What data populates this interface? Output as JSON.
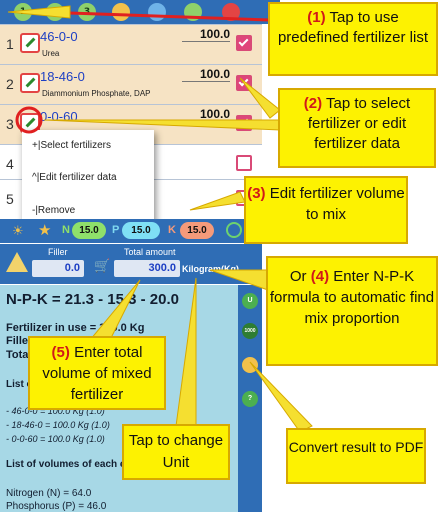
{
  "toolbar": {
    "icons": [
      "1",
      "2",
      "3",
      "pen",
      "globe",
      "4",
      "pdf"
    ]
  },
  "rows": [
    {
      "num": "1",
      "name": "46-0-0",
      "desc": "Urea",
      "value": "100.0",
      "checked": true
    },
    {
      "num": "2",
      "name": "18-46-0",
      "desc": "Diammonium Phosphate, DAP",
      "value": "100.0",
      "checked": true
    },
    {
      "num": "3",
      "name": "0-0-60",
      "desc": "",
      "value": "100.0",
      "checked": true
    },
    {
      "num": "4",
      "name": "",
      "desc": "",
      "value": "",
      "checked": false
    },
    {
      "num": "5",
      "name": "",
      "desc": "",
      "value": "",
      "checked": false
    }
  ],
  "menu": {
    "select": "+|Select fertilizers",
    "edit": "^|Edit fertilizer data",
    "remove": "-|Remove"
  },
  "npk": {
    "n_label": "N",
    "p_label": "P",
    "k_label": "K",
    "n": "15.0",
    "p": "15.0",
    "k": "15.0"
  },
  "filler": {
    "filler_label": "Filler",
    "filler_value": "0.0",
    "total_label": "Total amount",
    "total_value": "300.0",
    "unit": "Kilogram(Kg)"
  },
  "result": {
    "formula": "N-P-K = 21.3 - 15.3 - 20.0",
    "fert_in_use": "Fertilizer in use = 300.0 Kg",
    "filler_line": "Filler",
    "total_line": "Total am",
    "list_of": "List of",
    "items": [
      "- 46-0-0 = 100.0 Kg (1.0)",
      "- 18-46-0 = 100.0 Kg (1.0)",
      "- 0-0-60 = 100.0 Kg (1.0)"
    ],
    "volumes_heading": "List of volumes of each e",
    "nitrogen": "Nitrogen (N) = 64.0",
    "phosphorus": "Phosphorus (P) = 46.0"
  },
  "side_buttons": [
    "U",
    "1000",
    "pen",
    "?"
  ],
  "callouts": {
    "c1_num": "(1)",
    "c1_text": "Tap to use predefined fertilizer list",
    "c2_num": "(2)",
    "c2_text": "Tap to select fertilizer or edit fertilizer data",
    "c3_num": "(3)",
    "c3_text": "Edit fertilizer volume to mix",
    "c4_pre": "Or",
    "c4_num": "(4)",
    "c4_text": "Enter N-P-K formula to automatic find mix proportion",
    "c5_num": "(5)",
    "c5_text": "Enter total volume of mixed fertilizer",
    "unit_text": "Tap to change Unit",
    "pdf_text": "Convert result to PDF"
  },
  "colors": {
    "accent_blue": "#2f6db5",
    "callout_yellow": "#fdf201",
    "callout_red": "#d11919",
    "row_fill": "#f6e3c4"
  }
}
